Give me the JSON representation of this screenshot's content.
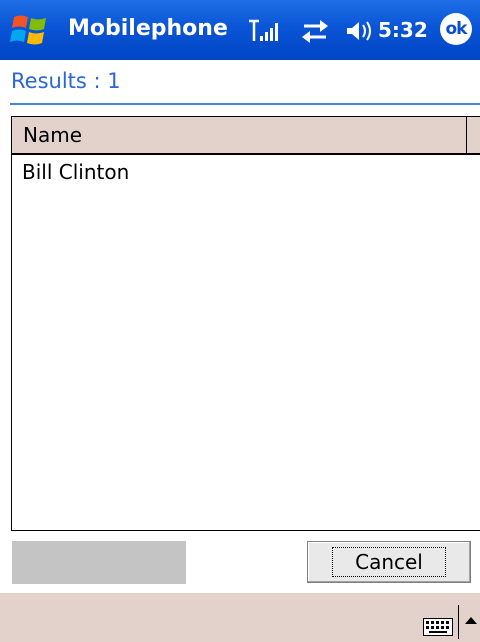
{
  "titlebar": {
    "app_title": "Mobilephone",
    "time": "5:32",
    "ok_label": "ok"
  },
  "results": {
    "label": "Results : 1"
  },
  "list": {
    "columns": [
      "Name"
    ],
    "rows": [
      {
        "name": "Bill Clinton"
      }
    ]
  },
  "buttons": {
    "cancel_label": "Cancel"
  },
  "icons": [
    "windows-logo-icon",
    "signal-strength-icon",
    "sync-icon",
    "volume-icon",
    "keyboard-icon",
    "arrow-up-icon"
  ]
}
